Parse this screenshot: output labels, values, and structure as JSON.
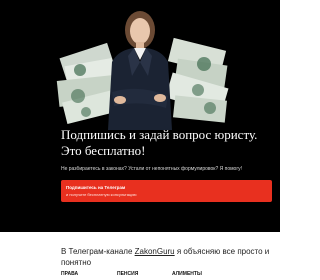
{
  "hero": {
    "headline": "Подпишись и задай вопрос юристу. Это бесплатно!",
    "subtext": "Не разбираетесь в законах? Устали от непонятных формулировок? Я помогу!",
    "cta": {
      "title": "Подпишитесь на Телеграм",
      "subtitle": "и получите бесплатную консультацию"
    }
  },
  "info": {
    "prefix": "В Телеграм-канале ",
    "channel": "ZakonGuru",
    "suffix": " я объясняю все просто и понятно"
  },
  "tabs": [
    {
      "label": "ПРАВА"
    },
    {
      "label": "ПЕНСИЯ"
    },
    {
      "label": "АЛИМЕНТЫ"
    }
  ],
  "colors": {
    "hero_background": "#000000",
    "cta_red": "#e8301f",
    "banknote_green": "#3f6b4e"
  }
}
